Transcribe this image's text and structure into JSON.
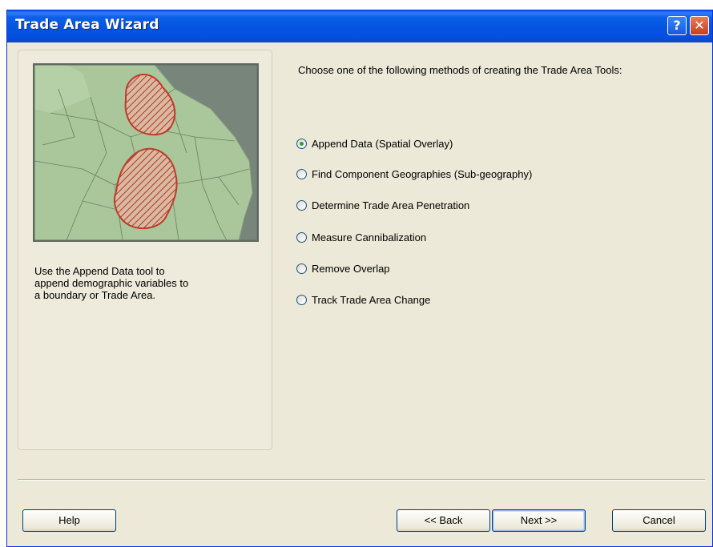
{
  "window": {
    "title": "Trade Area Wizard",
    "help_button": "?",
    "close_button": "✕"
  },
  "left_panel": {
    "description": "Use the Append Data tool to\nappend demographic variables to\na boundary or Trade Area."
  },
  "main": {
    "prompt": "Choose one of the following methods of creating the Trade Area Tools:",
    "options": [
      {
        "label": "Append Data (Spatial Overlay)",
        "checked": true
      },
      {
        "label": "Find  Component  Geographies  (Sub-geography)",
        "checked": false
      },
      {
        "label": "Determine Trade Area Penetration",
        "checked": false
      },
      {
        "label": "Measure Cannibalization",
        "checked": false
      },
      {
        "label": "Remove Overlap",
        "checked": false
      },
      {
        "label": "Track Trade Area Change",
        "checked": false
      }
    ]
  },
  "buttons": {
    "help": "Help",
    "back": "<< Back",
    "next": "Next >>",
    "cancel": "Cancel"
  },
  "colors": {
    "titlebar": "#0454e0",
    "map_land": "#a9c79a",
    "trade_area_outline": "#c0392b",
    "radio_dot": "#2aa02a"
  }
}
